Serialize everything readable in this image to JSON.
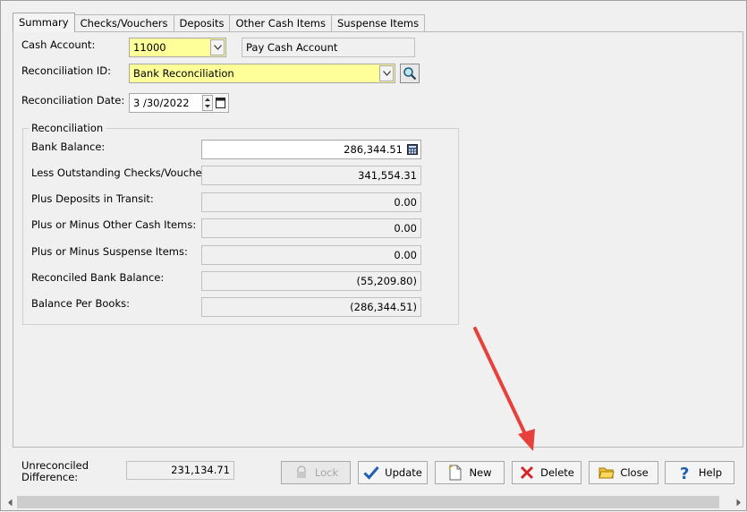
{
  "tabs": [
    {
      "label": "Summary"
    },
    {
      "label": "Checks/Vouchers"
    },
    {
      "label": "Deposits"
    },
    {
      "label": "Other Cash Items"
    },
    {
      "label": "Suspense Items"
    }
  ],
  "header": {
    "cash_account_label": "Cash Account:",
    "cash_account_value": "11000",
    "cash_account_desc": "Pay Cash Account",
    "recon_id_label": "Reconciliation ID:",
    "recon_id_value": "Bank Reconciliation",
    "recon_date_label": "Reconciliation Date:",
    "recon_date_value": "3 /30/2022"
  },
  "reconciliation": {
    "title": "Reconciliation",
    "rows": [
      {
        "label": "Bank Balance:",
        "value": "286,344.51"
      },
      {
        "label": "Less Outstanding Checks/Vouchers:",
        "value": "341,554.31"
      },
      {
        "label": "Plus Deposits in Transit:",
        "value": "0.00"
      },
      {
        "label": "Plus or Minus Other Cash Items:",
        "value": "0.00"
      },
      {
        "label": "Plus or Minus Suspense Items:",
        "value": "0.00"
      },
      {
        "label": "Reconciled Bank Balance:",
        "value": "(55,209.80)"
      },
      {
        "label": "Balance Per Books:",
        "value": "(286,344.51)"
      }
    ]
  },
  "footer": {
    "unreconciled_label_1": "Unreconciled",
    "unreconciled_label_2": "Difference:",
    "unreconciled_value": "231,134.71"
  },
  "buttons": {
    "lock": "Lock",
    "update": "Update",
    "new": "New",
    "delete": "Delete",
    "close": "Close",
    "help": "Help"
  },
  "colors": {
    "highlight_field": "#ffff99",
    "annotation_arrow": "#e8413b"
  }
}
